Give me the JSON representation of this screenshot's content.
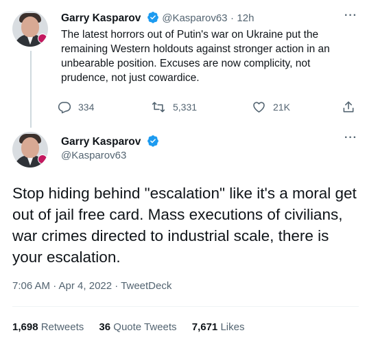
{
  "tweet1": {
    "author_name": "Garry Kasparov",
    "handle": "@Kasparov63",
    "separator": "·",
    "time": "12h",
    "text": "The latest horrors out of Putin's war on Ukraine put the remaining Western holdouts against stronger action in an unbearable position. Excuses are now complicity, not prudence, not just cowardice.",
    "actions": {
      "replies": "334",
      "retweets": "5,331",
      "likes": "21K"
    }
  },
  "tweet2": {
    "author_name": "Garry Kasparov",
    "handle": "@Kasparov63",
    "text": "Stop hiding behind \"escalation\" like it's a moral get out of jail free card. Mass executions of civilians, war crimes directed to industrial scale, there is your escalation.",
    "meta": "7:06 AM · Apr 4, 2022 · TweetDeck",
    "stats": {
      "retweets_count": "1,698",
      "retweets_label": "Retweets",
      "quote_count": "36",
      "quote_label": "Quote Tweets",
      "likes_count": "7,671",
      "likes_label": "Likes"
    }
  },
  "icons": {
    "verified": "verified-badge-icon",
    "reply": "reply-icon",
    "retweet": "retweet-icon",
    "like": "heart-icon",
    "share": "share-icon",
    "more": "more-icon"
  },
  "colors": {
    "verified": "#1d9bf0",
    "text": "#0f1419",
    "secondary": "#536471"
  }
}
